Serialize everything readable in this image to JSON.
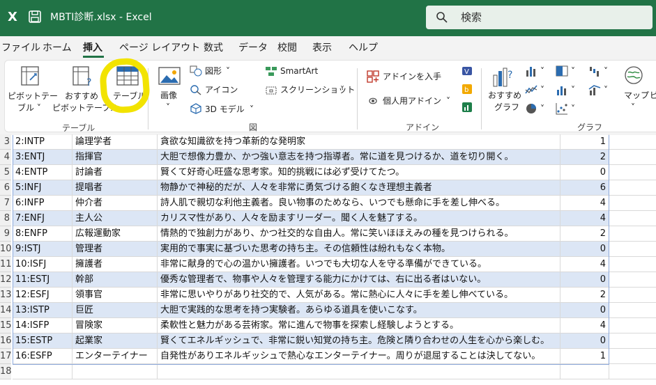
{
  "titlebar": {
    "logo": "X",
    "title": "MBTI診断.xlsx  -  Excel",
    "search_placeholder": "検索"
  },
  "menu": {
    "items": [
      "ファイル",
      "ホーム",
      "挿入",
      "ページ レイアウト",
      "数式",
      "データ",
      "校閲",
      "表示",
      "ヘルプ"
    ],
    "active": "挿入"
  },
  "ribbon": {
    "pivot_table": "ピボットテー\nブル",
    "pivot_table_l1": "ピボットテー",
    "pivot_table_l2": "ブル ˅",
    "rec_pivot_l1": "おすすめ",
    "rec_pivot_l2": "ピボットテーブル",
    "table": "テーブル",
    "image": "画像",
    "shapes": "図形",
    "icons": "アイコン",
    "model3d": "3D モデル",
    "smartart": "SmartArt",
    "screenshot": "スクリーンショット",
    "get_addins": "アドインを入手",
    "my_addins": "個人用アドイン",
    "rec_chart_l1": "おすすめ",
    "rec_chart_l2": "グラフ",
    "map": "マップ",
    "groups": {
      "table": "テーブル",
      "illustrations": "図",
      "addins": "アドイン",
      "charts": "グラフ"
    }
  },
  "sheet": {
    "row_numbers": [
      "3",
      "4",
      "5",
      "6",
      "7",
      "8",
      "9",
      "10",
      "11",
      "12",
      "13",
      "14",
      "15",
      "16",
      "17",
      "18"
    ],
    "rows": [
      {
        "code": "2:INTP",
        "name": "論理学者",
        "desc": "貪欲な知識欲を持つ革新的な発明家",
        "count": "1"
      },
      {
        "code": "3:ENTJ",
        "name": "指揮官",
        "desc": "大胆で想像力豊か、かつ強い意志を持つ指導者。常に道を見つけるか、道を切り開く。",
        "count": "2"
      },
      {
        "code": "4:ENTP",
        "name": "討論者",
        "desc": "賢くて好奇心旺盛な思考家。知的挑戦には必ず受けてたつ。",
        "count": "0"
      },
      {
        "code": "5:INFJ",
        "name": "提唱者",
        "desc": "物静かで神秘的だが、人々を非常に勇気づける飽くなき理想主義者",
        "count": "6"
      },
      {
        "code": "6:INFP",
        "name": "仲介者",
        "desc": "詩人肌で親切な利他主義者。良い物事のためなら、いつでも懸命に手を差し伸べる。",
        "count": "4"
      },
      {
        "code": "7:ENFJ",
        "name": "主人公",
        "desc": "カリスマ性があり、人々を励ますリーダー。聞く人を魅了する。",
        "count": "4"
      },
      {
        "code": "8:ENFP",
        "name": "広報運動家",
        "desc": "情熱的で独創力があり、かつ社交的な自由人。常に笑いほほえみの種を見つけられる。",
        "count": "2"
      },
      {
        "code": "9:ISTJ",
        "name": "管理者",
        "desc": "実用的で事実に基づいた思考の持ち主。その信頼性は紛れもなく本物。",
        "count": "0"
      },
      {
        "code": "10:ISFJ",
        "name": "擁護者",
        "desc": "非常に献身的で心の温かい擁護者。いつでも大切な人を守る準備ができている。",
        "count": "4"
      },
      {
        "code": "11:ESTJ",
        "name": "幹部",
        "desc": "優秀な管理者で、物事や人々を管理する能力にかけては、右に出る者はいない。",
        "count": "0"
      },
      {
        "code": "12:ESFJ",
        "name": "領事官",
        "desc": "非常に思いやりがあり社交的で、人気がある。常に熱心に人々に手を差し伸べている。",
        "count": "2"
      },
      {
        "code": "13:ISTP",
        "name": "巨匠",
        "desc": "大胆で実践的な思考を持つ実験者。あらゆる道具を使いこなす。",
        "count": "0"
      },
      {
        "code": "14:ISFP",
        "name": "冒険家",
        "desc": "柔軟性と魅力がある芸術家。常に進んで物事を探索し経験しようとする。",
        "count": "4"
      },
      {
        "code": "15:ESTP",
        "name": "起業家",
        "desc": "賢くてエネルギッシュで、非常に鋭い知覚の持ち主。危険と隣り合わせの人生を心から楽しむ。",
        "count": "0"
      },
      {
        "code": "16:ESFP",
        "name": "エンターテイナー",
        "desc": "自発性がありエネルギッシュで熱心なエンターテイナー。周りが退屈することは決してない。",
        "count": "1"
      }
    ]
  },
  "colors": {
    "excel_green": "#217346",
    "band_blue": "#dce6f5",
    "highlight_yellow": "#f2e300"
  }
}
